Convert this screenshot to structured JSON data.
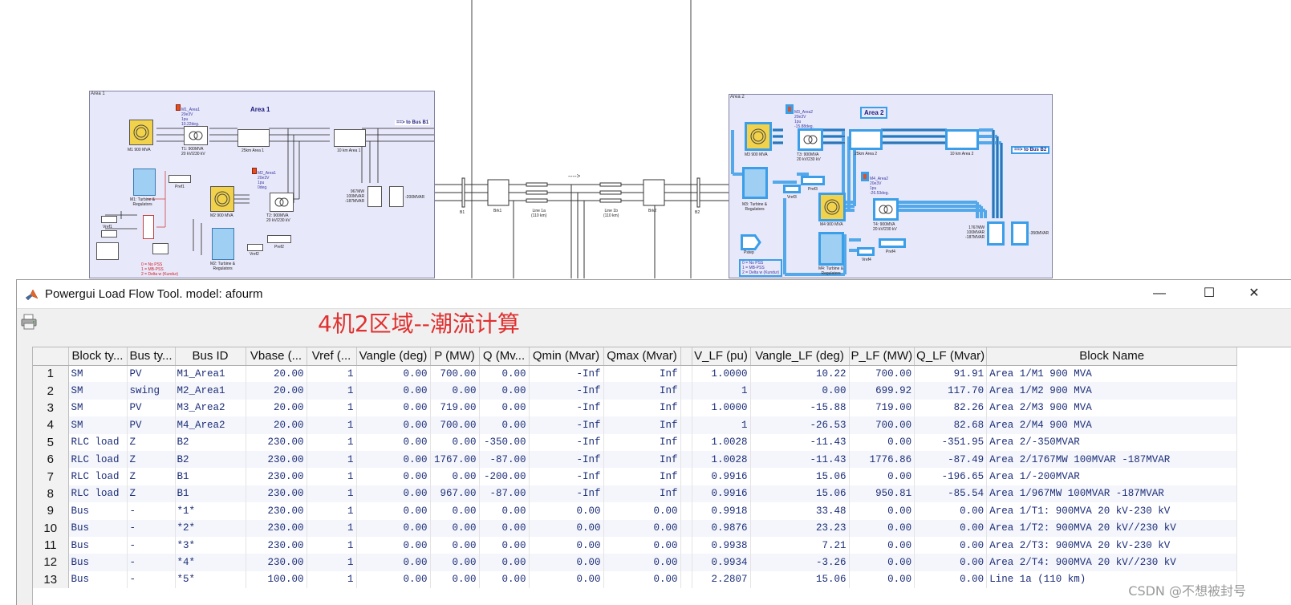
{
  "diagram": {
    "area1": {
      "tag": "Area 1",
      "title": "Area 1",
      "to_bus": "==> to Bus B1",
      "labels": {
        "m1": "M1 900 MVA",
        "t1": "T1: 900MVA\n20 kV/230 kV",
        "line25": "25km Area 1",
        "line10": "10 km Area 1",
        "m2": "M2 900 MVA",
        "t2": "T2: 900MVA\n20 kV/230 kV",
        "turb1": "M1: Turbine &\nRegulators",
        "turb2": "M2: Turbine &\nRegulators",
        "pref1": "Pref1",
        "pref2": "Pref2",
        "vref1": "Vref1",
        "vref2": "Vref2",
        "load": "967MW\n100MVAR\n-187MVAR",
        "cap": "-200MVAR",
        "m1_note": "M1_Area1\n20e3V\n1pu\n10.22deg.",
        "m2_note": "M2_Area1\n20e3V\n1pu\n0deg.",
        "pss_note": "0 = No PSS\n1 = MB-PSS\n2 = Delta w (Kundur)"
      }
    },
    "area2": {
      "tag": "Area 2",
      "title": "Area 2",
      "to_bus": "==> to Bus B2",
      "labels": {
        "m3": "M3 900 MVA",
        "t3": "T3: 900MVA\n20 kV/230 kV",
        "line25": "25km Area 2",
        "line10": "10 km Area 2",
        "m4": "M4 900 MVA",
        "t4": "T4: 900MVA\n20 kV/230 kV",
        "turb3": "M3: Turbine &\nRegulators",
        "turb4": "M4: Turbine &\nRegulators",
        "pref3": "Pref3",
        "pref4": "Pref4",
        "vref3": "Vref3",
        "vref4": "Vref4",
        "load": "1767MW\n100MVAR\n-187MVAR",
        "cap": "-350MVAR",
        "m3_note": "M3_Area2\n20e3V\n1pu\n-15.88deg.",
        "m4_note": "M4_Area2\n20e3V\n1pu\n-26.53deg.",
        "pss_note": "0 = No PSS\n1 = MB-PSS\n2 = Delta w (Kundur)",
        "pstep": "Pstep"
      }
    },
    "tie": {
      "b1": "B1",
      "brk1": "Brk1",
      "line1a": "Line 1a\n(110 km)",
      "line1b": "Line 1b\n(110 km)",
      "brk2": "Brk2",
      "b2": "B2"
    }
  },
  "window": {
    "title": "Powergui Load Flow Tool. model: afourm",
    "minimize": "—",
    "maximize": "☐",
    "close": "✕",
    "annotation": "4机2区域--潮流计算",
    "print_icon": "printer-icon"
  },
  "table": {
    "columns": [
      "Block ty...",
      "Bus ty...",
      "Bus ID",
      "Vbase (...",
      "Vref (...",
      "Vangle (deg)",
      "P (MW)",
      "Q (Mv...",
      "Qmin (Mvar)",
      "Qmax (Mvar)",
      "",
      "V_LF (pu)",
      "Vangle_LF (deg)",
      "P_LF (MW)",
      "Q_LF (Mvar)",
      "Block Name"
    ],
    "rows": [
      [
        "1",
        "SM",
        "PV",
        "M1_Area1",
        "20.00",
        "1",
        "0.00",
        "700.00",
        "0.00",
        "-Inf",
        "Inf",
        "1.0000",
        "10.22",
        "700.00",
        "91.91",
        "Area 1/M1 900 MVA"
      ],
      [
        "2",
        "SM",
        "swing",
        "M2_Area1",
        "20.00",
        "1",
        "0.00",
        "0.00",
        "0.00",
        "-Inf",
        "Inf",
        "1",
        "0.00",
        "699.92",
        "117.70",
        "Area 1/M2 900 MVA"
      ],
      [
        "3",
        "SM",
        "PV",
        "M3_Area2",
        "20.00",
        "1",
        "0.00",
        "719.00",
        "0.00",
        "-Inf",
        "Inf",
        "1.0000",
        "-15.88",
        "719.00",
        "82.26",
        "Area 2/M3 900 MVA"
      ],
      [
        "4",
        "SM",
        "PV",
        "M4_Area2",
        "20.00",
        "1",
        "0.00",
        "700.00",
        "0.00",
        "-Inf",
        "Inf",
        "1",
        "-26.53",
        "700.00",
        "82.68",
        "Area 2/M4 900 MVA"
      ],
      [
        "5",
        "RLC load",
        "Z",
        "B2",
        "230.00",
        "1",
        "0.00",
        "0.00",
        "-350.00",
        "-Inf",
        "Inf",
        "1.0028",
        "-11.43",
        "0.00",
        "-351.95",
        "Area 2/-350MVAR"
      ],
      [
        "6",
        "RLC load",
        "Z",
        "B2",
        "230.00",
        "1",
        "0.00",
        "1767.00",
        "-87.00",
        "-Inf",
        "Inf",
        "1.0028",
        "-11.43",
        "1776.86",
        "-87.49",
        "Area 2/1767MW 100MVAR -187MVAR"
      ],
      [
        "7",
        "RLC load",
        "Z",
        "B1",
        "230.00",
        "1",
        "0.00",
        "0.00",
        "-200.00",
        "-Inf",
        "Inf",
        "0.9916",
        "15.06",
        "0.00",
        "-196.65",
        "Area 1/-200MVAR"
      ],
      [
        "8",
        "RLC load",
        "Z",
        "B1",
        "230.00",
        "1",
        "0.00",
        "967.00",
        "-87.00",
        "-Inf",
        "Inf",
        "0.9916",
        "15.06",
        "950.81",
        "-85.54",
        "Area 1/967MW 100MVAR -187MVAR"
      ],
      [
        "9",
        "Bus",
        "-",
        "*1*",
        "230.00",
        "1",
        "0.00",
        "0.00",
        "0.00",
        "0.00",
        "0.00",
        "0.9918",
        "33.48",
        "0.00",
        "0.00",
        "Area 1/T1: 900MVA 20 kV-230 kV"
      ],
      [
        "10",
        "Bus",
        "-",
        "*2*",
        "230.00",
        "1",
        "0.00",
        "0.00",
        "0.00",
        "0.00",
        "0.00",
        "0.9876",
        "23.23",
        "0.00",
        "0.00",
        "Area 1/T2: 900MVA  20 kV//230 kV"
      ],
      [
        "11",
        "Bus",
        "-",
        "*3*",
        "230.00",
        "1",
        "0.00",
        "0.00",
        "0.00",
        "0.00",
        "0.00",
        "0.9938",
        "7.21",
        "0.00",
        "0.00",
        "Area 2/T3: 900MVA 20 kV-230 kV"
      ],
      [
        "12",
        "Bus",
        "-",
        "*4*",
        "230.00",
        "1",
        "0.00",
        "0.00",
        "0.00",
        "0.00",
        "0.00",
        "0.9934",
        "-3.26",
        "0.00",
        "0.00",
        "Area 2/T4: 900MVA  20 kV//230 kV"
      ],
      [
        "13",
        "Bus",
        "-",
        "*5*",
        "100.00",
        "1",
        "0.00",
        "0.00",
        "0.00",
        "0.00",
        "0.00",
        "2.2807",
        "15.06",
        "0.00",
        "0.00",
        "Line 1a (110 km)"
      ]
    ]
  },
  "watermark": "CSDN @不想被封号",
  "colors": {
    "annotation": "#e03030",
    "table_text": "#1c2e78",
    "area_fill": "#e8e8fb",
    "selection": "#3a9ee8"
  }
}
